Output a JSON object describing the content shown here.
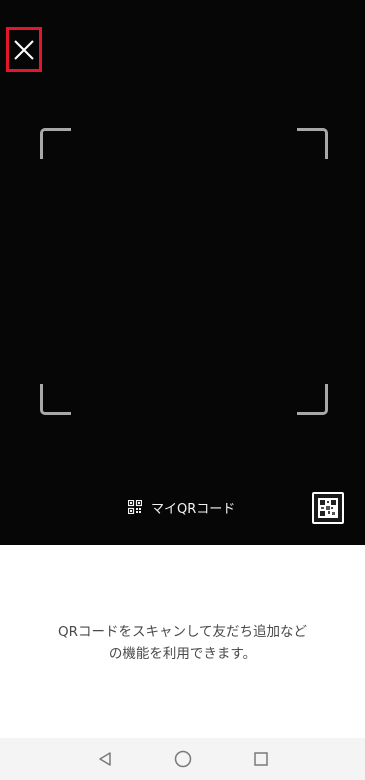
{
  "scanner": {
    "close_icon": "close-icon",
    "my_qr_label": "マイQRコード",
    "my_qr_icon": "qr-code-icon",
    "gallery_icon": "qr-thumbnail-icon"
  },
  "info": {
    "line1": "QRコードをスキャンして友だち追加など",
    "line2": "の機能を利用できます。"
  },
  "navbar": {
    "back_icon": "back-triangle-icon",
    "home_icon": "home-circle-icon",
    "recents_icon": "recents-square-icon"
  },
  "colors": {
    "camera_bg": "#060606",
    "highlight": "#e3162b",
    "frame_corners": "#a8a8a8"
  }
}
